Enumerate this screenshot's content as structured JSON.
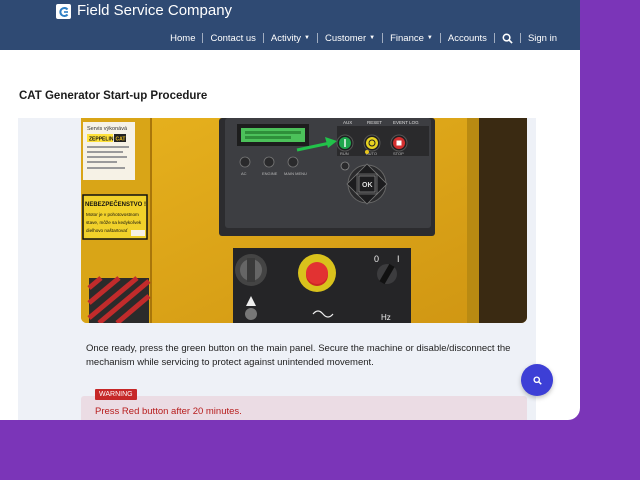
{
  "header": {
    "brand": "Field Service Company",
    "nav": [
      {
        "label": "Home",
        "dropdown": false
      },
      {
        "label": "Contact us",
        "dropdown": false
      },
      {
        "label": "Activity",
        "dropdown": true
      },
      {
        "label": "Customer",
        "dropdown": true
      },
      {
        "label": "Finance",
        "dropdown": true
      },
      {
        "label": "Accounts",
        "dropdown": false
      }
    ],
    "search_icon": "search-icon",
    "signin": "Sign in",
    "colors": {
      "bar": "#2f4a73",
      "text": "#ffffff"
    }
  },
  "page": {
    "title": "CAT Generator Start-up Procedure"
  },
  "photo": {
    "sticker_lines": [
      "Servis výkonává",
      "ZEPPELIN",
      "CAT"
    ],
    "danger_sign": [
      "NEBEZPEČENSTVO !",
      "Motor je v pohotovostnom",
      "stave, môže sa kedykoľvek",
      "dielhovo naštartovať"
    ],
    "panel_labels": [
      "AUX",
      "RESET",
      "EVENT LOG"
    ],
    "button_labels": [
      "RUN",
      "AUTO",
      "STOP"
    ],
    "control_labels": [
      "AC",
      "ENGINE",
      "MAIN MENU"
    ],
    "switch_labels": [
      "0",
      "I"
    ],
    "meter_label": "Hz",
    "ok_label": "OK"
  },
  "content": {
    "instruction": "Once ready, press the green button on the main panel. Secure the machine or disable/disconnect the mechanism while servicing to protect against unintended movement.",
    "warning_badge": "WARNING",
    "warning_text": "Press Red button after 20 minutes."
  },
  "fab": {
    "icon": "search-icon"
  },
  "colors": {
    "accent": "#3d3fd6",
    "warning": "#c62828",
    "background": "#7b35b8"
  }
}
